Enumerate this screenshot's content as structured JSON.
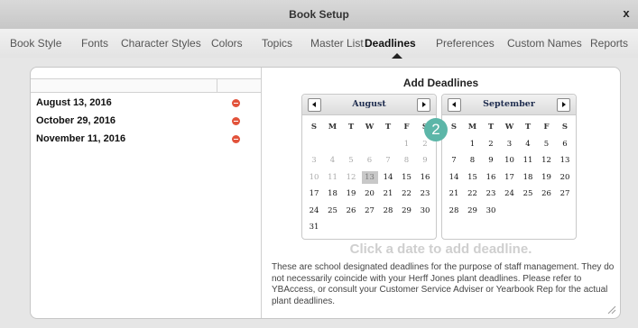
{
  "window": {
    "title": "Book Setup",
    "close_label": "x"
  },
  "tabs": [
    {
      "label": "Book Style",
      "active": false
    },
    {
      "label": "Fonts",
      "active": false
    },
    {
      "label": "Character Styles",
      "active": false
    },
    {
      "label": "Colors",
      "active": false
    },
    {
      "label": "Topics",
      "active": false
    },
    {
      "label": "Master List",
      "active": false
    },
    {
      "label": "Deadlines",
      "active": true
    },
    {
      "label": "Preferences",
      "active": false
    },
    {
      "label": "Custom Names",
      "active": false
    },
    {
      "label": "Reports",
      "active": false
    }
  ],
  "deadlines": [
    {
      "date": "August 13, 2016",
      "action_icon": "remove-icon"
    },
    {
      "date": "October 29, 2016",
      "action_icon": "remove-icon"
    },
    {
      "date": "November 11, 2016",
      "action_icon": "remove-icon"
    }
  ],
  "add_panel": {
    "title": "Add Deadlines",
    "hint": "Click a date to add deadline.",
    "note": "These are school designated deadlines for the purpose of staff management. They do not necessarily coincide with your Herff Jones plant deadlines. Please refer to YBAccess, or consult your Customer Service Adviser or Yearbook Rep for the actual plant deadlines."
  },
  "weekdays": [
    "S",
    "M",
    "T",
    "W",
    "T",
    "F",
    "S"
  ],
  "calendars": [
    {
      "month": "August",
      "first_weekday": 5,
      "days": 31,
      "disabled_through": 13,
      "highlighted_day": 13
    },
    {
      "month": "September",
      "first_weekday": 1,
      "days": 30,
      "disabled_through": 0,
      "highlighted_day": null
    }
  ],
  "badge": {
    "number": "2"
  },
  "colors": {
    "remove": "#e2533b",
    "badge": "#5cb6a8",
    "hint": "#cfcfcf",
    "month_text": "#1f2d4f"
  }
}
